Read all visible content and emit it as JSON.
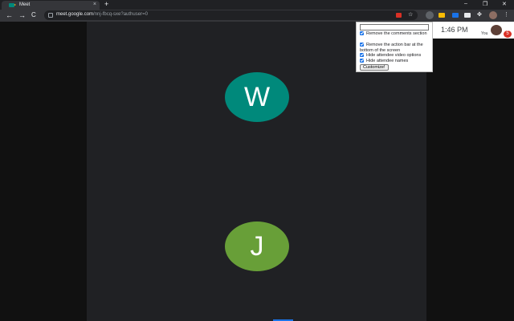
{
  "browser": {
    "tab_title": "Meet",
    "tab_close": "×",
    "new_tab": "+",
    "minimize": "–",
    "restore": "❐",
    "close": "✕",
    "back": "←",
    "forward": "→",
    "reload": "C",
    "url_host": "meet.google.com",
    "url_path": "/nnj-fbcq-sxe?authuser=0",
    "menu": "⋮"
  },
  "meet": {
    "time": "1:46 PM",
    "self_label": "You",
    "notification_count": "5",
    "participants": [
      {
        "initial": "W",
        "color": "#00897b"
      },
      {
        "initial": "J",
        "color": "#689f38"
      }
    ]
  },
  "popup": {
    "text_value": "",
    "options": [
      {
        "label": "Remove the comments section",
        "checked": true
      },
      {
        "label": "Remove the action bar at the bottom of the screen",
        "checked": true
      },
      {
        "label": "Hide attendee video options",
        "checked": true
      },
      {
        "label": "Hide attendee names",
        "checked": true
      }
    ],
    "button": "Customize!"
  }
}
